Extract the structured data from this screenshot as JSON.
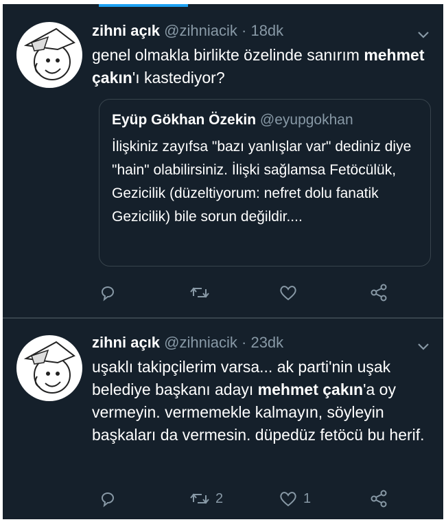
{
  "tweets": [
    {
      "name": "zihni açık",
      "handle": "@zihniacik",
      "sep": "·",
      "time": "18dk",
      "text_a": "genel olmakla birlikte özelinde sanırım ",
      "text_b": "mehmet çakın",
      "text_c": "'ı kastediyor?",
      "quote": {
        "name": "Eyüp Gökhan Özekin",
        "handle": "@eyupgokhan",
        "text": "İlişkiniz zayıfsa \"bazı yanlışlar var\" dediniz diye \"hain\" olabilirsiniz. İlişki sağlamsa Fetöcülük, Gezicilik (düzeltiyorum: nefret dolu fanatik Gezicilik) bile sorun değildir...."
      },
      "actions": {
        "reply": "",
        "retweet": "",
        "like": "",
        "share": ""
      }
    },
    {
      "name": "zihni açık",
      "handle": "@zihniacik",
      "sep": "·",
      "time": "23dk",
      "text_a": "uşaklı takipçilerim varsa... ak parti'nin uşak belediye başkanı adayı ",
      "text_b": "mehmet çakın",
      "text_c": "'a oy vermeyin. vermemekle kalmayın, söyleyin başkaları da vermesin. düpedüz fetöcü bu herif.",
      "actions": {
        "reply": "",
        "retweet": "2",
        "like": "1",
        "share": ""
      }
    }
  ],
  "icons": {
    "reply": "reply-icon",
    "retweet": "retweet-icon",
    "like": "heart-icon",
    "share": "share-icon",
    "menu": "chevron-down-icon"
  },
  "colors": {
    "background": "#15202b",
    "text": "#ffffff",
    "muted": "#8899a6",
    "border": "#38444d",
    "accent": "#1da1f2"
  }
}
